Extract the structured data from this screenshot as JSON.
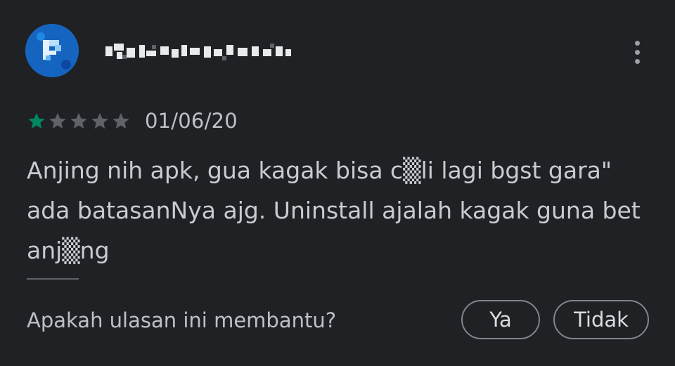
{
  "review": {
    "author_avatar_icon": "avatar-icon",
    "username_redacted_icon": "redacted-name-icon",
    "more_icon": "more-vert-icon",
    "rating": 1,
    "rating_max": 5,
    "rating_color": "#01875f",
    "date": "01/06/20",
    "text": "Anjing nih apk, gua kagak bisa c▒li lagi bgst gara\"\nada batasanNya ajg. Uninstall ajalah kagak guna bet\nanj▒ng"
  },
  "helpful": {
    "question": "Apakah ulasan ini membantu?",
    "yes_label": "Ya",
    "no_label": "Tidak"
  }
}
